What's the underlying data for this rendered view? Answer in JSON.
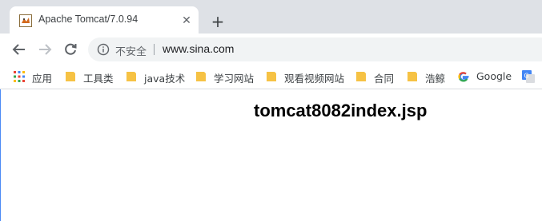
{
  "tab": {
    "title": "Apache Tomcat/7.0.94",
    "close_glyph": "✕",
    "favicon": "tomcat-favicon-icon"
  },
  "new_tab_glyph": "+",
  "toolbar": {
    "back_icon": "back-arrow-icon",
    "forward_icon": "forward-arrow-icon",
    "reload_icon": "reload-icon"
  },
  "omnibox": {
    "security_label": "不安全",
    "url": "www.sina.com"
  },
  "bookmarks": [
    {
      "label": "应用",
      "icon": "apps-grid-icon"
    },
    {
      "label": "工具类",
      "icon": "folder-icon"
    },
    {
      "label": "java技术",
      "icon": "folder-icon"
    },
    {
      "label": "学习网站",
      "icon": "folder-icon"
    },
    {
      "label": "观看视频网站",
      "icon": "folder-icon"
    },
    {
      "label": "合同",
      "icon": "folder-icon"
    },
    {
      "label": "浩鲸",
      "icon": "folder-icon"
    },
    {
      "label": "Google",
      "icon": "google-icon"
    }
  ],
  "page": {
    "heading": "tomcat8082index.jsp"
  },
  "colors": {
    "tabstrip": "#dee1e6",
    "omnibox": "#f1f3f4",
    "folder": "#f6c244",
    "accent": "#4c8bf5"
  }
}
